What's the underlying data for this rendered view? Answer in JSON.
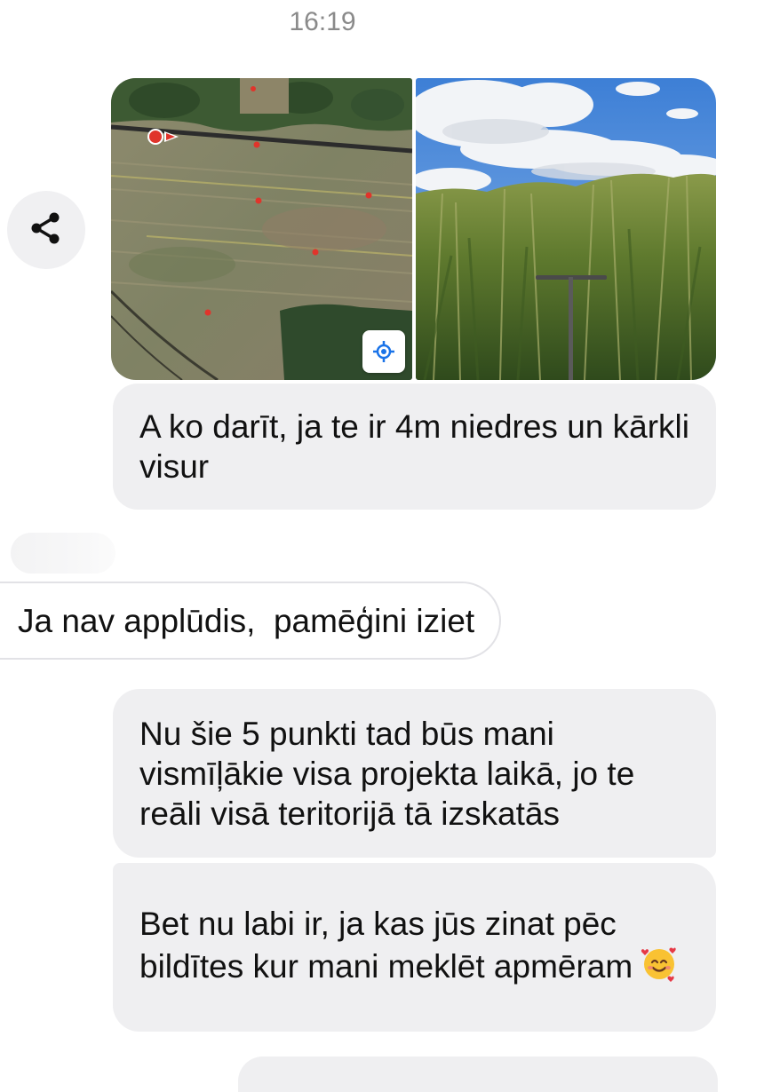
{
  "conversation": {
    "timestamp": "16:19"
  },
  "media": {
    "map_marker_count": 5,
    "photo_description_icon": "reed-field-photo"
  },
  "messages": {
    "out_1": "A ko darīt, ja te ir 4m niedres un kārkli visur",
    "in_1": "Ja nav applūdis,  pamēģini iziet",
    "out_2": "Nu šie 5 punkti tad būs mani vismīļākie visa projekta laikā, jo te reāli visā teritorijā tā izskatās",
    "out_3": "Bet nu labi ir, ja kas jūs zinat pēc bildītes kur mani meklēt apmēram"
  },
  "icons": {
    "share": "share-icon",
    "locate": "my-location-icon",
    "emoji": "smiling-face-with-hearts-emoji"
  },
  "colors": {
    "bubble_outgoing": "#efeff1",
    "bubble_incoming_border": "#e2e2e6",
    "timestamp": "#8a8a8a",
    "map_pin": "#e0342b",
    "locate_icon": "#1a73e8"
  }
}
